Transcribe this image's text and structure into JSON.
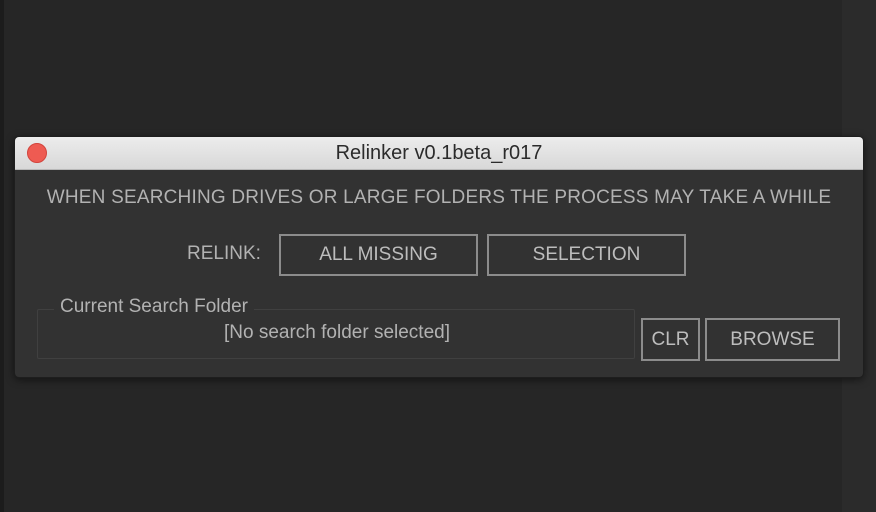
{
  "window": {
    "title": "Relinker v0.1beta_r017"
  },
  "panel": {
    "warning": "WHEN SEARCHING DRIVES OR LARGE FOLDERS THE PROCESS MAY TAKE A WHILE",
    "relink_label": "RELINK:",
    "all_missing_label": "ALL MISSING",
    "selection_label": "SELECTION",
    "search_folder": {
      "legend": "Current Search Folder",
      "value": "[No search folder selected]"
    },
    "clear_label": "CLR",
    "browse_label": "BROWSE"
  },
  "colors": {
    "background": "#262626",
    "window_body": "#323232",
    "titlebar": "#e2e2e2",
    "close_button": "#ee5b52",
    "text": "#b2b2b2",
    "button_border": "#8c8c8c"
  },
  "icons": {
    "close": "close-circle-icon"
  }
}
